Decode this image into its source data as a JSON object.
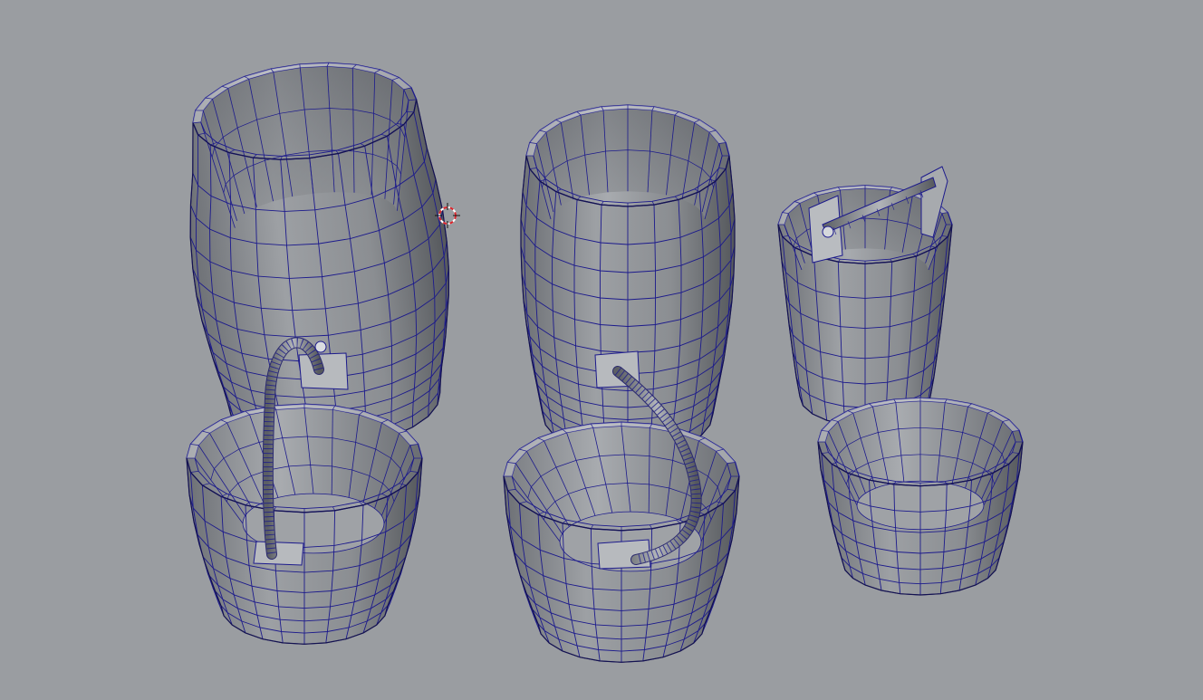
{
  "viewport": {
    "background_color": "#9a9da1",
    "wire_color": "#1c1a8c",
    "surface_color": "#8f9296",
    "shade_dark": "#55585d",
    "shade_light": "#c8cbcf",
    "cursor_color": "#d8242b"
  },
  "objects": [
    {
      "name": "tall-barrel-left",
      "kind": "barrel"
    },
    {
      "name": "tall-barrel-center",
      "kind": "barrel"
    },
    {
      "name": "small-bucket-with-bar-handle",
      "kind": "bucket"
    },
    {
      "name": "bucket-with-rope-handle-left",
      "kind": "bucket"
    },
    {
      "name": "bucket-with-rope-handle-center",
      "kind": "bucket"
    },
    {
      "name": "tub-right",
      "kind": "tub"
    }
  ],
  "cursor": {
    "icon": "3d-cursor-icon"
  }
}
